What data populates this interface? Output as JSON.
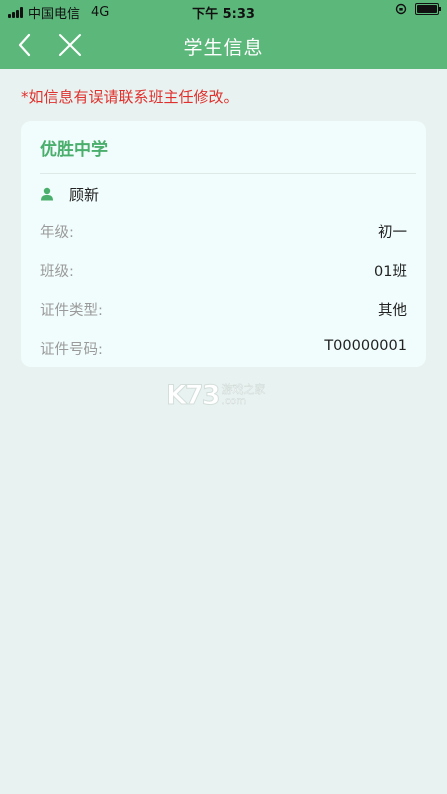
{
  "status_bar": {
    "carrier": "中国电信",
    "network": "4G",
    "time": "下午 5:33",
    "icons": [
      "signal-icon",
      "orientation-lock-icon",
      "battery-icon"
    ]
  },
  "nav": {
    "title": "学生信息",
    "back_icon": "back-arrow-icon",
    "close_icon": "close-icon"
  },
  "notice": "*如信息有误请联系班主任修改。",
  "card": {
    "school": "优胜中学",
    "student_name": "顾新",
    "student_icon": "user-icon",
    "fields": [
      {
        "label": "年级:",
        "value": "初一"
      },
      {
        "label": "班级:",
        "value": "01班"
      },
      {
        "label": "证件类型:",
        "value": "其他"
      },
      {
        "label": "证件号码:",
        "value": "T00000001"
      }
    ]
  },
  "watermark": {
    "logo": "K73",
    "text": "游戏之家",
    "domain": ".com"
  },
  "colors": {
    "header_bg": "#5cb77b",
    "page_bg": "#e8f3f1",
    "card_bg": "#f1fdfc",
    "school_text": "#4aae6c",
    "notice_text": "#e0302d"
  }
}
